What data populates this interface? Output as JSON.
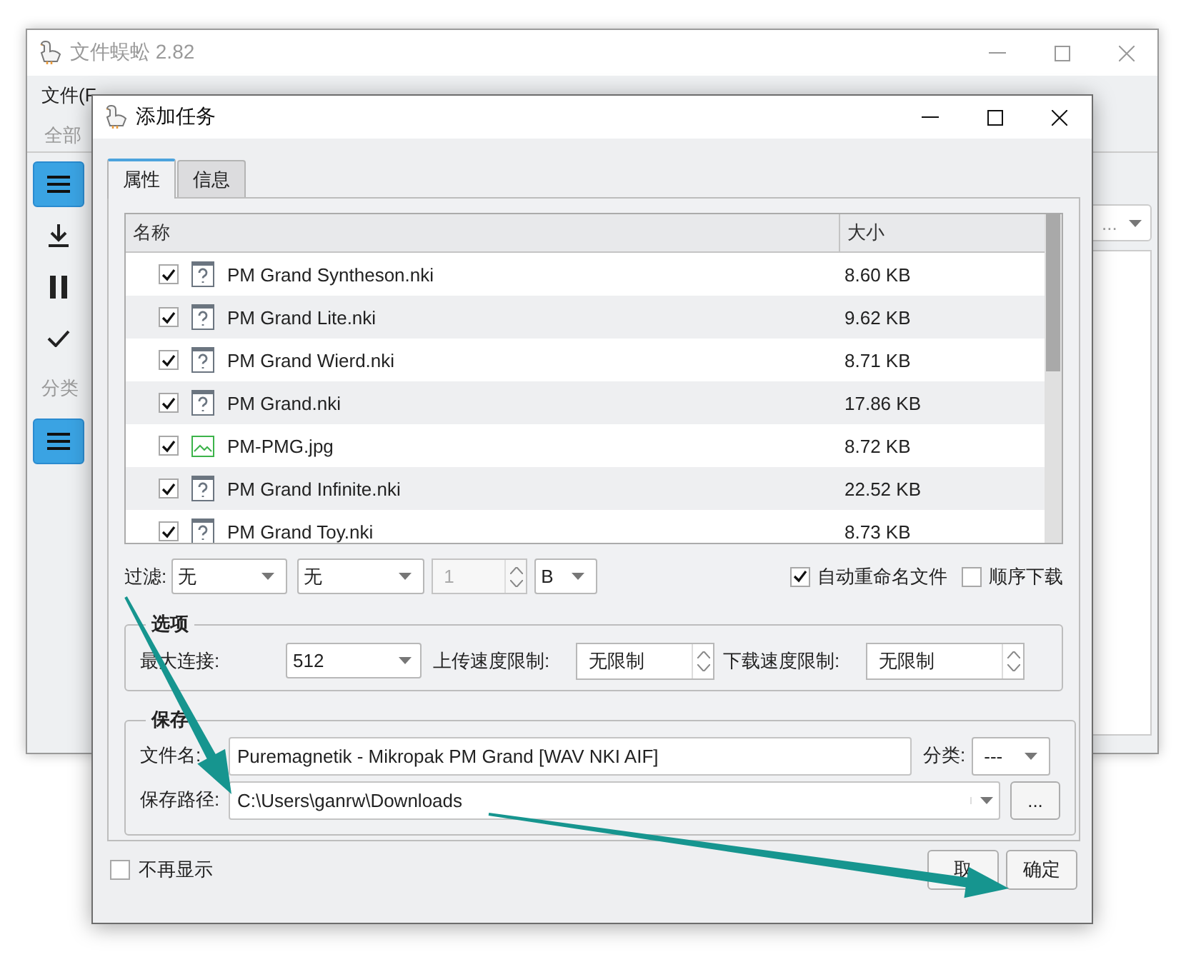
{
  "main_window": {
    "title": "文件蜈蚣 2.82",
    "menu": [
      "文件(F"
    ],
    "section_label": "全部",
    "category_label": "分类",
    "sidebar": [
      {
        "kind": "list",
        "selected": true
      },
      {
        "kind": "download",
        "selected": false
      },
      {
        "kind": "pause",
        "selected": false
      },
      {
        "kind": "check",
        "selected": false
      }
    ],
    "category_items": [
      {
        "kind": "list",
        "selected": true
      }
    ],
    "combo_text": "..."
  },
  "dialog": {
    "title": "添加任务",
    "tabs": [
      {
        "label": "属性",
        "selected": true
      },
      {
        "label": "信息",
        "selected": false
      }
    ],
    "table": {
      "columns": [
        "名称",
        "大小"
      ],
      "rows": [
        {
          "name": "PM Grand Syntheson.nki",
          "size": "8.60 KB",
          "checked": true,
          "kind": "unknown"
        },
        {
          "name": "PM Grand Lite.nki",
          "size": "9.62 KB",
          "checked": true,
          "kind": "unknown"
        },
        {
          "name": "PM Grand Wierd.nki",
          "size": "8.71 KB",
          "checked": true,
          "kind": "unknown"
        },
        {
          "name": "PM Grand.nki",
          "size": "17.86 KB",
          "checked": true,
          "kind": "unknown"
        },
        {
          "name": "PM-PMG.jpg",
          "size": "8.72 KB",
          "checked": true,
          "kind": "image"
        },
        {
          "name": "PM Grand Infinite.nki",
          "size": "22.52 KB",
          "checked": true,
          "kind": "unknown"
        },
        {
          "name": "PM Grand Toy.nki",
          "size": "8.73 KB",
          "checked": true,
          "kind": "unknown"
        }
      ]
    },
    "filter": {
      "label": "过滤:",
      "select_1": "无",
      "select_2": "无",
      "size_value": "1",
      "size_disabled": true,
      "unit": "B",
      "options": [
        {
          "label": "自动重命名文件",
          "checked": true
        },
        {
          "label": "顺序下载",
          "checked": false
        }
      ]
    },
    "options": {
      "title": "选项",
      "max_connections_label": "最大连接:",
      "max_connections": "512",
      "upload_label": "上传速度限制:",
      "upload": "无限制",
      "download_label": "下载速度限制:",
      "download": "无限制"
    },
    "save": {
      "title": "保存",
      "filename_label": "文件名:",
      "filename": "Puremagnetik - Mikropak PM Grand [WAV NKI AIF]",
      "category_label": "分类:",
      "category": "---",
      "path_label": "保存路径:",
      "path": "C:\\Users\\ganrw\\Downloads",
      "browse": "..."
    },
    "dont_show": {
      "label": "不再显示",
      "checked": false
    },
    "buttons": [
      "取",
      "确定"
    ]
  }
}
